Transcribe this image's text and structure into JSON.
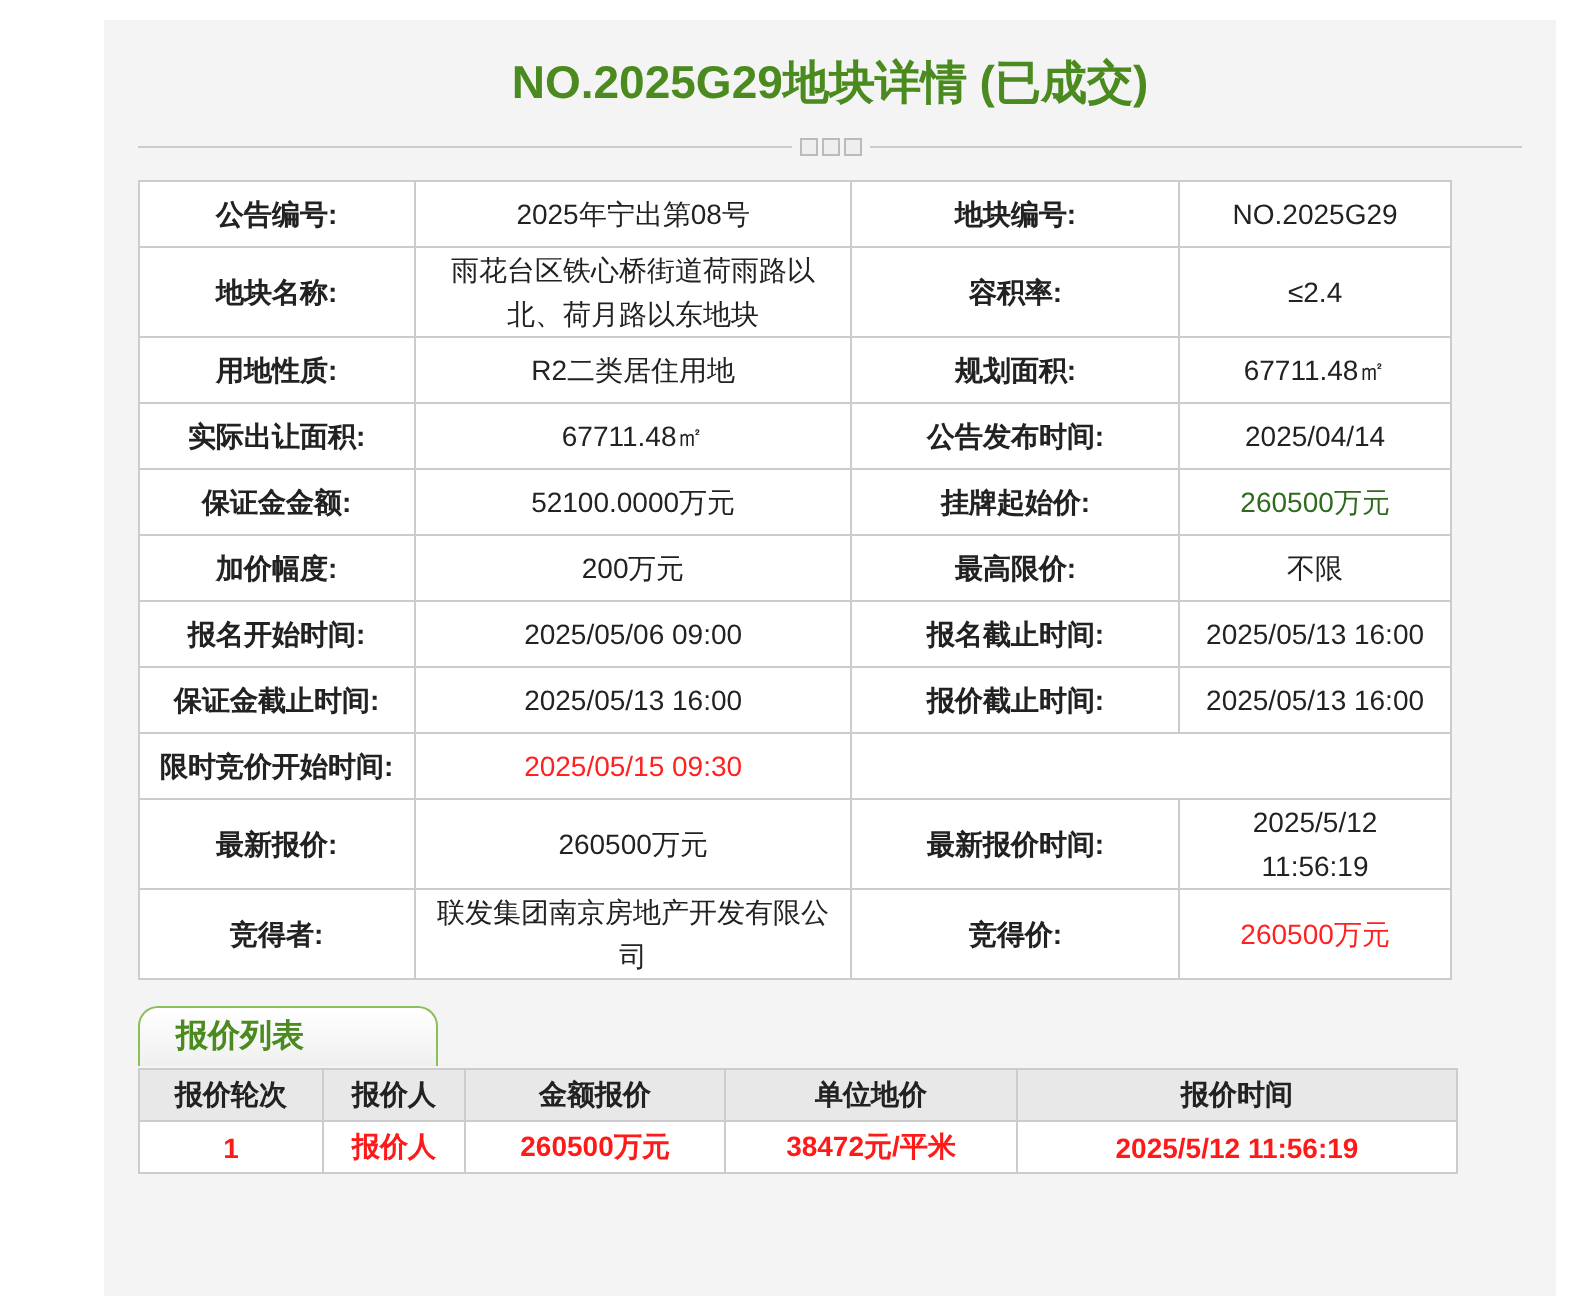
{
  "title": "NO.2025G29地块详情 (已成交)",
  "details": [
    [
      {
        "label": "公告编号:",
        "value": "2025年宁出第08号"
      },
      {
        "label": "地块编号:",
        "value": "NO.2025G29"
      }
    ],
    [
      {
        "label": "地块名称:",
        "value": "雨花台区铁心桥街道荷雨路以北、荷月路以东地块"
      },
      {
        "label": "容积率:",
        "value": "≤2.4"
      }
    ],
    [
      {
        "label": "用地性质:",
        "value": "R2二类居住用地"
      },
      {
        "label": "规划面积:",
        "value": "67711.48㎡"
      }
    ],
    [
      {
        "label": "实际出让面积:",
        "value": "67711.48㎡"
      },
      {
        "label": "公告发布时间:",
        "value": "2025/04/14"
      }
    ],
    [
      {
        "label": "保证金金额:",
        "value": "52100.0000万元"
      },
      {
        "label": "挂牌起始价:",
        "value": "260500万元",
        "color": "#2e6b1f"
      }
    ],
    [
      {
        "label": "加价幅度:",
        "value": "200万元"
      },
      {
        "label": "最高限价:",
        "value": "不限"
      }
    ],
    [
      {
        "label": "报名开始时间:",
        "value": "2025/05/06 09:00"
      },
      {
        "label": "报名截止时间:",
        "value": "2025/05/13 16:00"
      }
    ],
    [
      {
        "label": "保证金截止时间:",
        "value": "2025/05/13 16:00"
      },
      {
        "label": "报价截止时间:",
        "value": "2025/05/13 16:00"
      }
    ],
    [
      {
        "label": "限时竞价开始时间:",
        "value": "2025/05/15 09:30",
        "color": "#ff2020"
      }
    ],
    [
      {
        "label": "最新报价:",
        "value": "260500万元"
      },
      {
        "label": "最新报价时间:",
        "value": "2025/5/12 11:56:19"
      }
    ],
    [
      {
        "label": "竞得者:",
        "value": "联发集团南京房地产开发有限公司"
      },
      {
        "label": "竞得价:",
        "value": "260500万元",
        "color": "#ff2020"
      }
    ]
  ],
  "bid_list": {
    "tab": "报价列表",
    "columns": [
      "报价轮次",
      "报价人",
      "金额报价",
      "单位地价",
      "报价时间"
    ],
    "rows": [
      [
        "1",
        "报价人",
        "260500万元",
        "38472元/平米",
        "2025/5/12 11:56:19"
      ]
    ]
  }
}
